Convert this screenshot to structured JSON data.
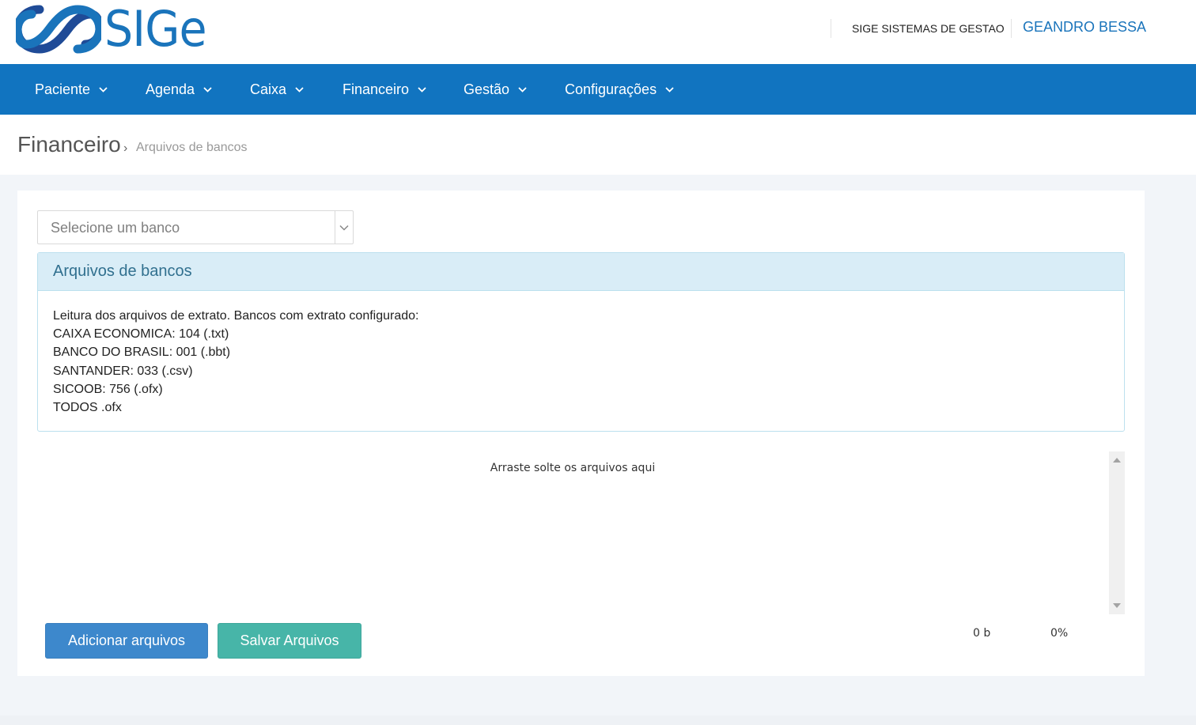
{
  "header": {
    "logo_text": "SIGe",
    "company": "SIGE SISTEMAS DE GESTAO",
    "user": "GEANDRO BESSA",
    "brand_color": "#1174c0"
  },
  "nav": {
    "items": [
      {
        "label": "Paciente",
        "icon": "chevron-down-icon"
      },
      {
        "label": "Agenda",
        "icon": "chevron-down-icon"
      },
      {
        "label": "Caixa",
        "icon": "chevron-down-icon"
      },
      {
        "label": "Financeiro",
        "icon": "chevron-down-icon"
      },
      {
        "label": "Gestão",
        "icon": "chevron-down-icon"
      },
      {
        "label": "Configurações",
        "icon": "chevron-down-icon"
      }
    ]
  },
  "breadcrumb": {
    "section": "Financeiro",
    "separator": "›",
    "page": "Arquivos de bancos"
  },
  "bank_select": {
    "placeholder": "Selecione um banco"
  },
  "panel": {
    "title": "Arquivos de bancos",
    "lines": [
      "Leitura dos arquivos de extrato. Bancos com extrato configurado:",
      "CAIXA ECONOMICA: 104 (.txt)",
      "BANCO DO BRASIL: 001 (.bbt)",
      "SANTANDER: 033 (.csv)",
      "SICOOB: 756 (.ofx)",
      "TODOS .ofx"
    ]
  },
  "dropzone": {
    "text": "Arraste solte os arquivos aqui"
  },
  "actions": {
    "add_label": "Adicionar arquivos",
    "save_label": "Salvar Arquivos"
  },
  "upload_status": {
    "size": "0 b",
    "percent": "0%"
  }
}
